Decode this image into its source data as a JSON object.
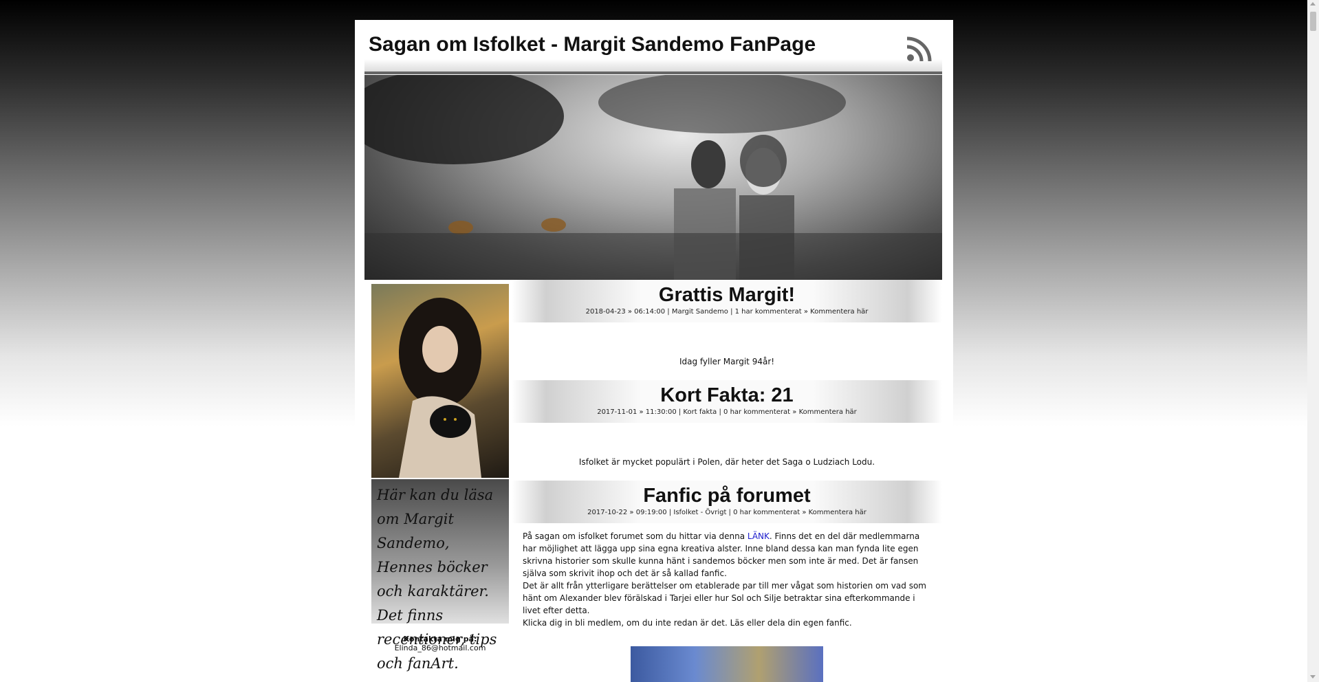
{
  "header": {
    "title": "Sagan om Isfolket - Margit Sandemo FanPage",
    "rss_icon": "rss-icon"
  },
  "sidebar": {
    "intro_text": "Här kan du läsa om Margit Sandemo, Hennes böcker och karaktärer. Det finns recentioner, tips och fanArt.",
    "contact_label": "Kontakta mig på:",
    "contact_email": "Elinda_86@hotmail.com"
  },
  "posts": [
    {
      "title": "Grattis Margit!",
      "meta": "2018-04-23 » 06:14:00 | Margit Sandemo | 1 har kommenterat » Kommentera här",
      "body": "Idag fyller Margit 94år!"
    },
    {
      "title": "Kort Fakta: 21",
      "meta": "2017-11-01 » 11:30:00 | Kort fakta | 0 har kommenterat » Kommentera här",
      "body": "Isfolket är mycket populärt i Polen, där heter det Saga o Ludziach Lodu."
    },
    {
      "title": "Fanfic på forumet",
      "meta": "2017-10-22 » 09:19:00 | Isfolket - Övrigt | 0 har kommenterat » Kommentera här",
      "body_p1_pre": "På sagan om isfolket forumet som du hittar via denna ",
      "body_p1_link": "LÄNK",
      "body_p1_post": ". Finns det en del där medlemmarna har möjlighet att lägga upp sina egna kreativa alster. Inne bland dessa kan man fynda lite egen skrivna historier som skulle kunna hänt i sandemos böcker men som inte är med. Det är fansen själva som skrivit ihop och det är så kallad fanfic.",
      "body_p2": "Det är allt från ytterligare berättelser om etablerade par till mer vågat som historien om vad som hänt om Alexander blev förälskad i Tarjei eller hur Sol och Silje betraktar sina efterkommande i livet efter detta.",
      "body_p3": "Klicka dig in bli medlem, om du inte redan är det. Läs eller dela din egen fanfic."
    }
  ]
}
